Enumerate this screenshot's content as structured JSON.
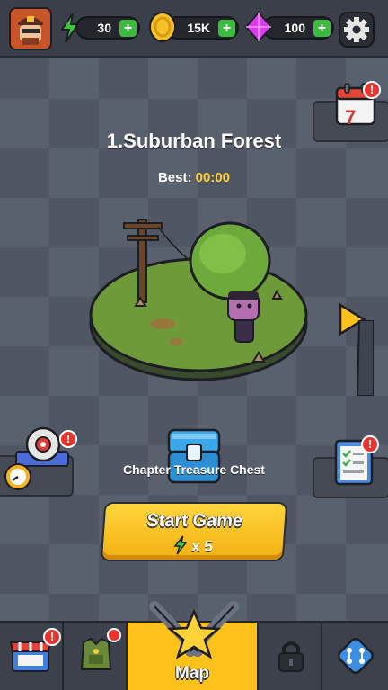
{
  "resources": {
    "energy": "30",
    "coins": "15K",
    "gems": "100",
    "plus_label": "+"
  },
  "level": {
    "title": "1.Suburban Forest",
    "best_label": "Best:",
    "best_time": "00:00"
  },
  "chest": {
    "label": "Chapter Treasure Chest"
  },
  "start": {
    "label": "Start Game",
    "cost": "x 5"
  },
  "calendar": {
    "day": "7"
  },
  "badges": {
    "alert": "!"
  },
  "nav": {
    "map_label": "Map"
  },
  "colors": {
    "accent": "#ffc21a",
    "badge": "#e8342d",
    "plus": "#3dbb3f",
    "gem": "#d93cf2",
    "coin": "#f6c12b"
  }
}
